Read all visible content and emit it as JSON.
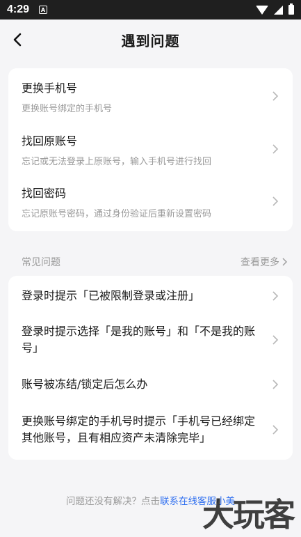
{
  "status_bar": {
    "time": "4:29",
    "notif_letter": "A"
  },
  "header": {
    "title": "遇到问题"
  },
  "account_options": [
    {
      "title": "更换手机号",
      "subtitle": "更换账号绑定的手机号"
    },
    {
      "title": "找回原账号",
      "subtitle": "忘记或无法登录上原账号，输入手机号进行找回"
    },
    {
      "title": "找回密码",
      "subtitle": "忘记原账号密码，通过身份验证后重新设置密码"
    }
  ],
  "faq": {
    "label": "常见问题",
    "more": "查看更多",
    "items": [
      "登录时提示「已被限制登录或注册」",
      "登录时提示选择「是我的账号」和「不是我的账号」",
      "账号被冻结/锁定后怎么办",
      "更换账号绑定的手机号时提示「手机号已经绑定其他账号，且有相应资产未清除完毕」"
    ]
  },
  "footer": {
    "prefix": "问题还没有解决？点击",
    "link": "联系在线客服小美"
  },
  "watermark": "大玩客",
  "colors": {
    "link": "#2f6ff0",
    "background": "#f5f5f7",
    "card": "#ffffff"
  }
}
